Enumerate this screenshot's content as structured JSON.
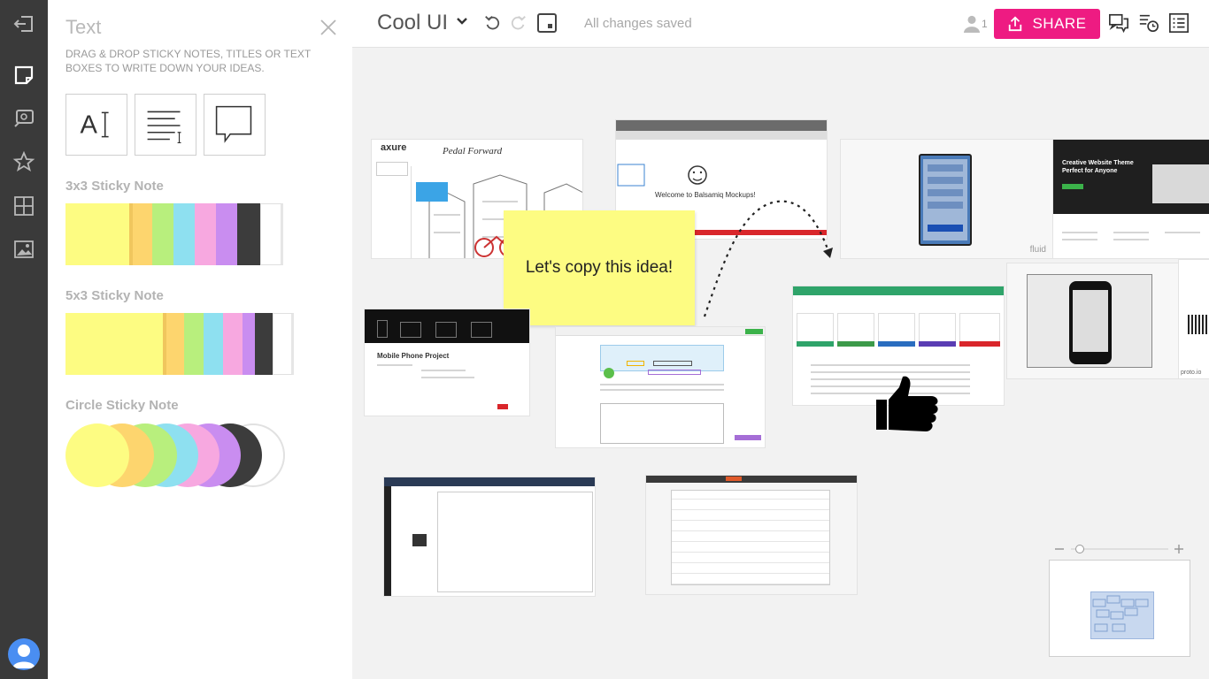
{
  "panel": {
    "title": "Text",
    "description": "Drag & drop sticky notes, titles or text boxes to write down your ideas.",
    "sections": {
      "sticky_3x3": "3x3 Sticky Note",
      "sticky_5x3": "5x3 Sticky Note",
      "sticky_circle": "Circle Sticky Note"
    },
    "note_colors": [
      "#fdfc82",
      "#fdd56e",
      "#b8ef7d",
      "#8ee0f0",
      "#f7a8e0",
      "#c98df0",
      "#3c3c3c",
      "#ffffff"
    ]
  },
  "rail": {
    "items": [
      "exit-icon",
      "sticky-note-icon",
      "comment-icon",
      "star-icon",
      "grid-icon",
      "image-icon"
    ]
  },
  "topbar": {
    "project_title": "Cool UI",
    "save_status": "All changes saved",
    "user_count": "1",
    "share_label": "SHARE"
  },
  "canvas": {
    "sticky_text": "Let's copy this idea!",
    "thumb_labels": {
      "axure": "axure",
      "pedal": "Pedal Forward",
      "balsamiq": "Welcome to Balsamiq Mockups!",
      "fluid": "fluid",
      "theme_heading": "Creative Website Theme Perfect for Anyone",
      "mobile_project": "Mobile Phone Project",
      "proto": "proto.io"
    }
  },
  "colors": {
    "accent": "#ee1b82",
    "rail_bg": "#3a3a3a",
    "sticky": "#fdfc82"
  }
}
